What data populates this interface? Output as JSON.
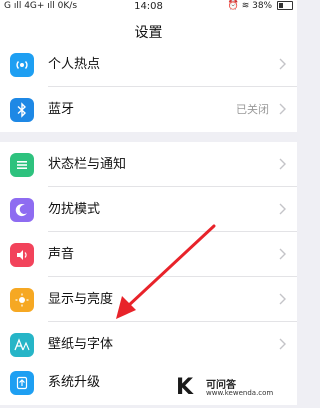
{
  "status_bar": {
    "left": "G ıll 4G+ ıll 0K/s",
    "time": "14:08",
    "right": "38%"
  },
  "nav": {
    "title": "设置"
  },
  "groups": [
    {
      "items": [
        {
          "label": "个人热点",
          "icon": "hotspot-icon",
          "color": "#1e9ff2"
        },
        {
          "label": "蓝牙",
          "value": "已关闭",
          "icon": "bluetooth-icon",
          "color": "#1e88e5"
        }
      ]
    },
    {
      "items": [
        {
          "label": "状态栏与通知",
          "icon": "notification-icon",
          "color": "#2ec27e"
        },
        {
          "label": "勿扰模式",
          "icon": "moon-icon",
          "color": "#8e6cf1"
        },
        {
          "label": "声音",
          "icon": "speaker-icon",
          "color": "#f2435b"
        },
        {
          "label": "显示与亮度",
          "icon": "brightness-icon",
          "color": "#f6a823"
        },
        {
          "label": "壁纸与字体",
          "icon": "wallpaper-font-icon",
          "color": "#26b5c7"
        }
      ]
    },
    {
      "items": [
        {
          "label": "系统升级",
          "icon": "system-update-icon",
          "color": "#1e9ff2"
        }
      ]
    }
  ],
  "watermark": {
    "logo": "K",
    "title": "可问答",
    "url": "www.kewenda.com"
  },
  "colors": {
    "arrow": "#e8232a",
    "background": "#efeff4"
  }
}
